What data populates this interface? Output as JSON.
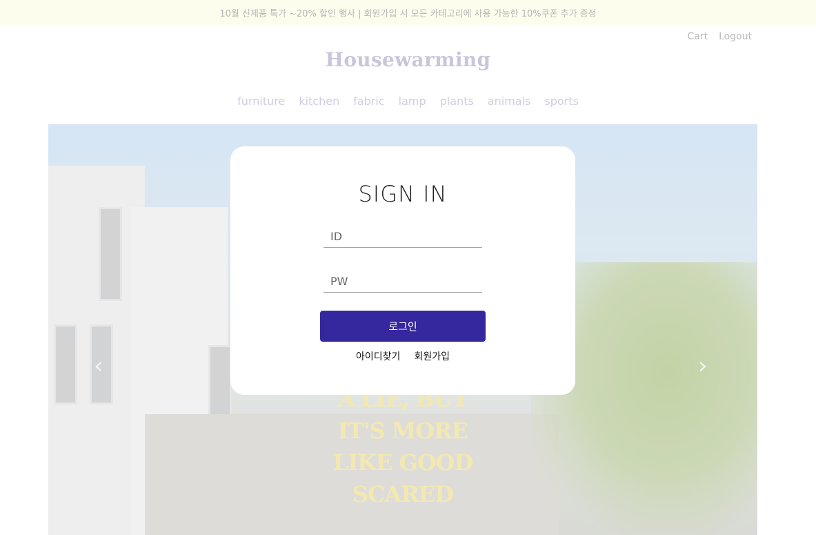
{
  "promo": {
    "text": "10월 신제품 특가 ~20% 할인 행사 | 회원가입 시 모든 카테고리에 사용 가능한 10%쿠폰 추가 증정"
  },
  "header": {
    "links": {
      "cart": "Cart",
      "logout": "Logout"
    },
    "logo": "Housewarming"
  },
  "nav": {
    "items": [
      {
        "label": "furniture"
      },
      {
        "label": "kitchen"
      },
      {
        "label": "fabric"
      },
      {
        "label": "lamp"
      },
      {
        "label": "plants"
      },
      {
        "label": "animals"
      },
      {
        "label": "sports"
      }
    ]
  },
  "hero": {
    "lines": [
      "A LIE, BUT",
      "IT'S MORE",
      "LIKE GOOD",
      "SCARED"
    ],
    "prev_arrow": "‹",
    "next_arrow": "›"
  },
  "login": {
    "title": "SIGN IN",
    "id_placeholder": "ID",
    "pw_placeholder": "PW",
    "submit_label": "로그인",
    "find_id": "아이디찾기",
    "signup": "회원가입"
  },
  "colors": {
    "accent": "#35289f",
    "promo_bg": "#fdfdee"
  }
}
